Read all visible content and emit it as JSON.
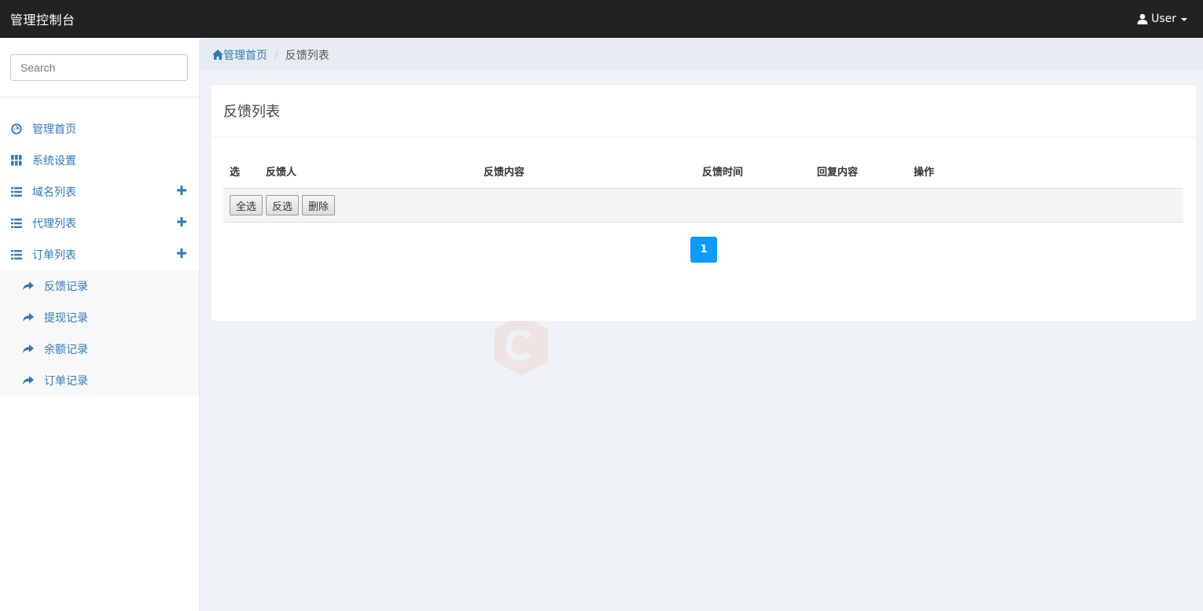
{
  "topbar": {
    "brand": "管理控制台",
    "user_label": "User"
  },
  "sidebar": {
    "search_placeholder": "Search",
    "items": [
      {
        "label": "管理首页",
        "icon": "dashboard-icon",
        "expandable": false
      },
      {
        "label": "系统设置",
        "icon": "grid-icon",
        "expandable": false
      },
      {
        "label": "域名列表",
        "icon": "list-icon",
        "expandable": true
      },
      {
        "label": "代理列表",
        "icon": "list-icon",
        "expandable": true
      },
      {
        "label": "订单列表",
        "icon": "list-icon",
        "expandable": true
      }
    ],
    "sub_items": [
      {
        "label": "反馈记录",
        "icon": "share-arrow-icon"
      },
      {
        "label": "提现记录",
        "icon": "share-arrow-icon"
      },
      {
        "label": "余额记录",
        "icon": "share-arrow-icon"
      },
      {
        "label": "订单记录",
        "icon": "share-arrow-icon"
      }
    ]
  },
  "breadcrumb": {
    "home": "管理首页",
    "current": "反馈列表"
  },
  "panel": {
    "title": "反馈列表",
    "columns": [
      "选",
      "反馈人",
      "反馈内容",
      "反馈时间",
      "回复内容",
      "操作"
    ],
    "buttons": {
      "select_all": "全选",
      "invert": "反选",
      "delete": "删除"
    },
    "page": "1"
  },
  "colors": {
    "topbar": "#222222",
    "link": "#337ab7",
    "pager": "#0d9bff",
    "background": "#eff2f6"
  }
}
